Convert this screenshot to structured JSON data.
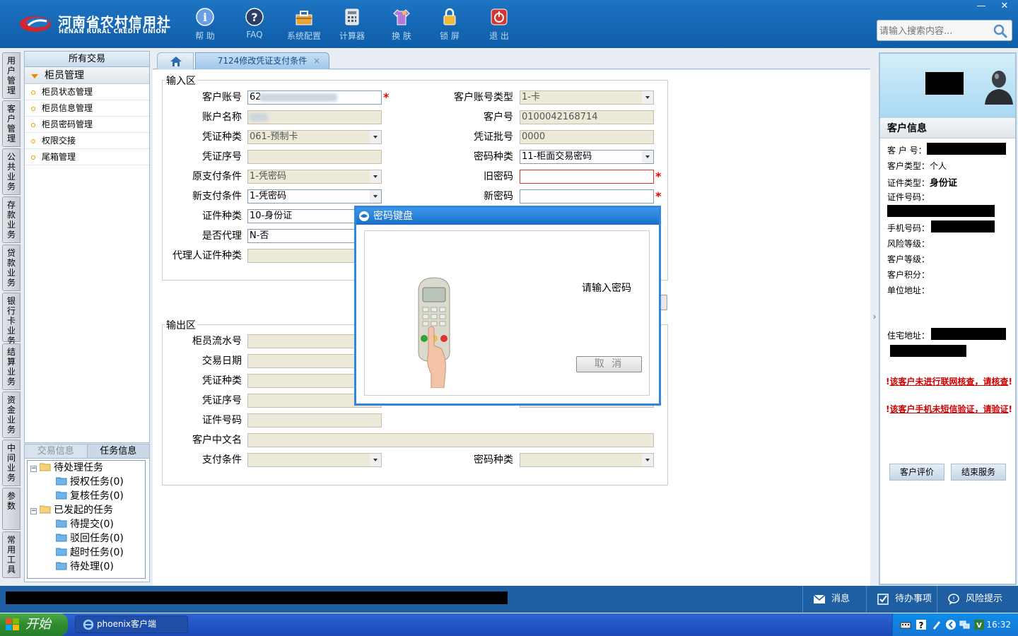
{
  "app": {
    "logo_cn": "河南省农村信用社",
    "logo_en": "HENAN RURAL CREDIT UNION",
    "toolbar": [
      {
        "label": "帮 助",
        "icon": "help-icon"
      },
      {
        "label": "FAQ",
        "icon": "faq-icon"
      },
      {
        "label": "系统配置",
        "icon": "toolbox-icon"
      },
      {
        "label": "计算器",
        "icon": "calculator-icon"
      },
      {
        "label": "换 肤",
        "icon": "shirt-icon"
      },
      {
        "label": "锁 屏",
        "icon": "lock-icon"
      },
      {
        "label": "退 出",
        "icon": "power-icon"
      }
    ],
    "window_min": "—",
    "window_close": "✕",
    "search_placeholder": "请输入搜索内容..."
  },
  "vertical_tabs": [
    "用户管理",
    "客户管理",
    "公共业务",
    "存款业务",
    "贷款业务",
    "银行卡业务",
    "结算业务",
    "资金业务",
    "中间业务",
    "参数",
    "常用工具"
  ],
  "leftnav": {
    "header": "所有交易",
    "group": "柜员管理",
    "items": [
      "柜员状态管理",
      "柜员信息管理",
      "柜员密码管理",
      "权限交接",
      "尾箱管理"
    ]
  },
  "taskpanel": {
    "tab1": "交易信息",
    "tab2": "任务信息",
    "tree": {
      "pending": "待处理任务",
      "auth": "授权任务(0)",
      "review": "复核任务(0)",
      "initiated": "已发起的任务",
      "to_submit": "待提交(0)",
      "rejected": "驳回任务(0)",
      "timeout": "超时任务(0)",
      "to_process": "待处理(0)"
    }
  },
  "tab": {
    "title": "7124修改凭证支付条件",
    "close": "×"
  },
  "input": {
    "legend": "输入区",
    "account_no_label": "客户账号",
    "account_no_prefix": "62",
    "account_type_label": "客户账号类型",
    "account_type": "1-卡",
    "account_name_label": "账户名称",
    "customer_no_label": "客户号",
    "customer_no": "0100042168714",
    "voucher_type_label": "凭证种类",
    "voucher_type": "061-预制卡",
    "voucher_batch_label": "凭证批号",
    "voucher_batch": "0000",
    "voucher_seq_label": "凭证序号",
    "pwd_type_label": "密码种类",
    "pwd_type": "11-柜面交易密码",
    "old_pay_label": "原支付条件",
    "old_pay": "1-凭密码",
    "old_pwd_label": "旧密码",
    "new_pay_label": "新支付条件",
    "new_pay": "1-凭密码",
    "new_pwd_label": "新密码",
    "id_type_label": "证件种类",
    "id_type": "10-身份证",
    "agent_label": "是否代理",
    "agent": "N-否",
    "agent_id_type_label": "代理人证件种类"
  },
  "output": {
    "legend": "输出区",
    "teller_seq_label": "柜员流水号",
    "date_label": "交易日期",
    "voucher_type_label": "凭证种类",
    "voucher_seq_label": "凭证序号",
    "id_no_label": "证件号码",
    "cn_name_label": "客户中文名",
    "pay_cond_label": "支付条件",
    "pwd_type_label": "密码种类"
  },
  "dialog": {
    "title": "密码键盘",
    "prompt": "请输入密码",
    "cancel": "取 消"
  },
  "customer": {
    "header": "客户信息",
    "no_label": "客 户 号：",
    "type_label": "客户类型：",
    "type": "个人",
    "id_type_label": "证件类型：",
    "id_type": "身份证",
    "id_no_label": "证件号码：",
    "phone_label": "手机号码：",
    "risk_label": "风险等级：",
    "level_label": "客户等级：",
    "points_label": "客户积分：",
    "company_addr_label": "单位地址：",
    "home_addr_label": "住宅地址：",
    "warn1": "该客户未进行联网核查，请核查",
    "warn2": "该客户手机未短信验证，请验证",
    "warn_mark": "!",
    "rate_btn": "客户评价",
    "end_btn": "结束服务"
  },
  "statusbar": {
    "message": "消息",
    "todo": "待办事项",
    "risk": "风险提示"
  },
  "taskbar": {
    "start": "开始",
    "item": "phoenix客户端",
    "clock": "16:32"
  },
  "colors": {
    "brand_blue": "#1d74c2",
    "required_red": "#e00000",
    "warning_red": "#cc0000"
  }
}
